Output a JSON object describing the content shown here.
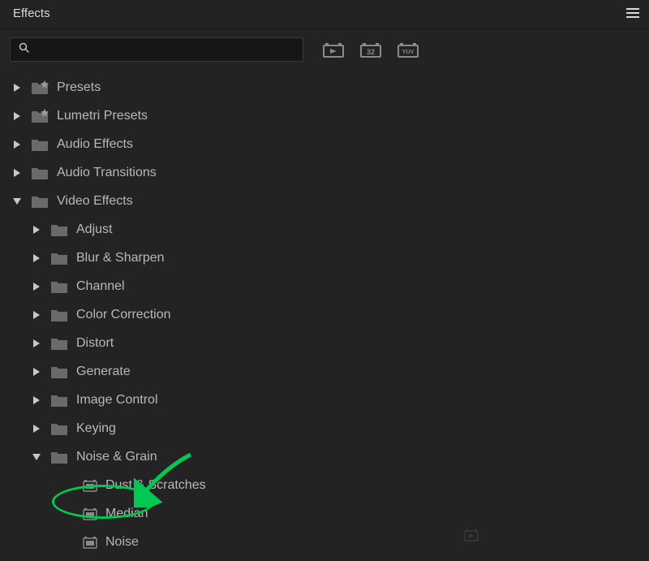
{
  "header": {
    "title": "Effects"
  },
  "search": {
    "placeholder": "",
    "value": ""
  },
  "toolbar_buttons": {
    "preset_btn": "preset",
    "badge_32": "32",
    "badge_yuv": "YUV"
  },
  "tree": {
    "root": [
      {
        "label": "Presets",
        "expanded": false,
        "starred": true
      },
      {
        "label": "Lumetri Presets",
        "expanded": false,
        "starred": true
      },
      {
        "label": "Audio Effects",
        "expanded": false,
        "starred": false
      },
      {
        "label": "Audio Transitions",
        "expanded": false,
        "starred": false
      },
      {
        "label": "Video Effects",
        "expanded": true,
        "starred": false
      }
    ],
    "video_effects_children": [
      {
        "label": "Adjust",
        "expanded": false
      },
      {
        "label": "Blur & Sharpen",
        "expanded": false
      },
      {
        "label": "Channel",
        "expanded": false
      },
      {
        "label": "Color Correction",
        "expanded": false
      },
      {
        "label": "Distort",
        "expanded": false
      },
      {
        "label": "Generate",
        "expanded": false
      },
      {
        "label": "Image Control",
        "expanded": false
      },
      {
        "label": "Keying",
        "expanded": false
      },
      {
        "label": "Noise & Grain",
        "expanded": true
      }
    ],
    "noise_grain_children": [
      {
        "label": "Dust & Scratches"
      },
      {
        "label": "Median"
      },
      {
        "label": "Noise"
      }
    ]
  },
  "annotation": {
    "highlighted_item": "Median"
  }
}
